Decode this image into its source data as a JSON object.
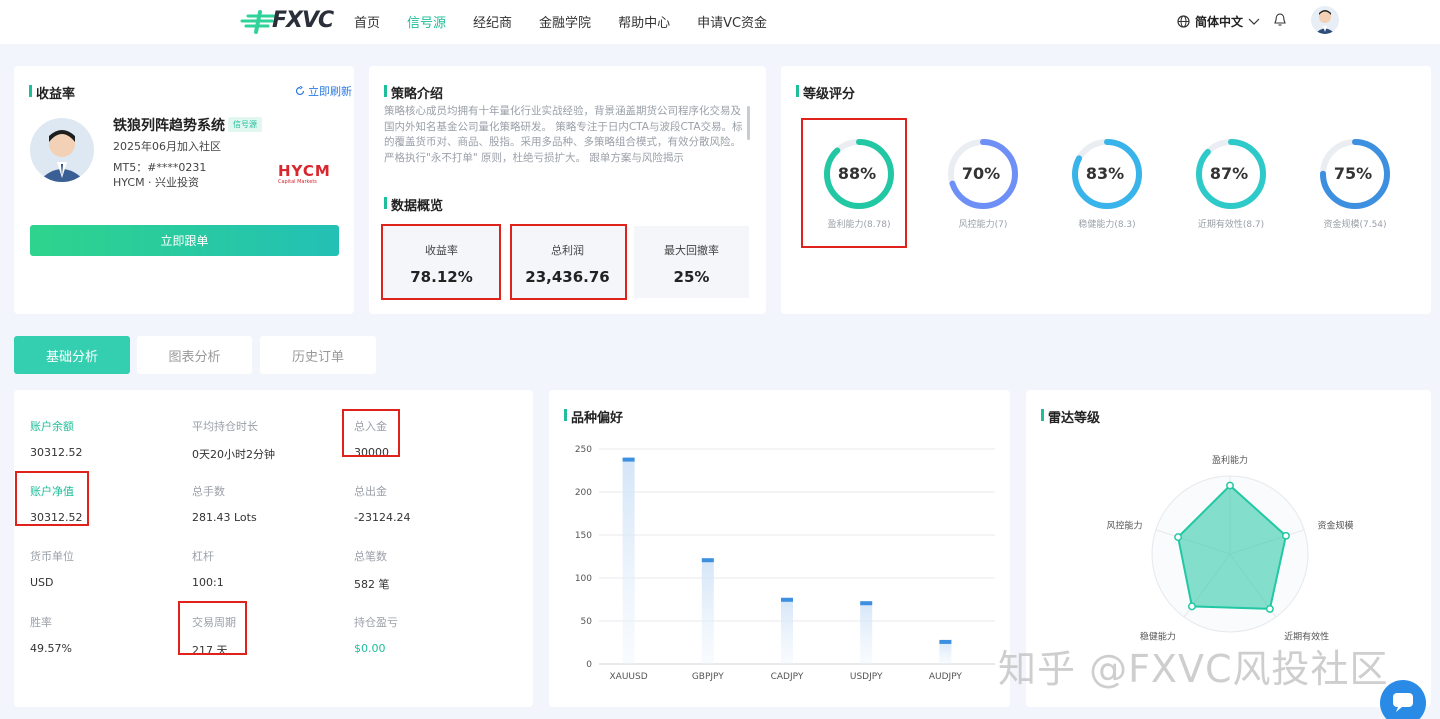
{
  "header": {
    "logo_text": "FXVC",
    "nav": [
      "首页",
      "信号源",
      "经纪商",
      "金融学院",
      "帮助中心",
      "申请VC资金"
    ],
    "active_nav": "信号源",
    "language": "简体中文"
  },
  "profile": {
    "section_title": "收益率",
    "refresh": "立即刷新",
    "name": "铁狼列阵趋势系统",
    "badge": "信号源",
    "joined": "2025年06月加入社区",
    "account": "MT5：#****0231",
    "broker_line": "HYCM · 兴业投资",
    "broker_logo": "HYCM",
    "broker_logo_sub": "Capital Markets",
    "follow": "立即跟单"
  },
  "strategy": {
    "section_title": "策略介绍",
    "text": "策略核心成员均拥有十年量化行业实战经验，背景涵盖期货公司程序化交易及国内外知名基金公司量化策略研发。 策略专注于日内CTA与波段CTA交易。标的覆盖货币对、商品、股指。采用多品种、多策略组合模式，有效分散风险。严格执行\"永不打单\" 原则，杜绝亏损扩大。 跟单方案与风险揭示",
    "overview_title": "数据概览",
    "stats": [
      {
        "label": "收益率",
        "value": "78.12%"
      },
      {
        "label": "总利润",
        "value": "23,436.76"
      },
      {
        "label": "最大回撤率",
        "value": "25%"
      }
    ]
  },
  "rating": {
    "section_title": "等级评分",
    "gauges": [
      {
        "value": "88%",
        "label": "盈利能力(8.78)",
        "pct": 88,
        "color": "#22c7a4"
      },
      {
        "value": "70%",
        "label": "风控能力(7)",
        "pct": 70,
        "color": "#6e8ff5"
      },
      {
        "value": "83%",
        "label": "稳健能力(8.3)",
        "pct": 83,
        "color": "#38b4ea"
      },
      {
        "value": "87%",
        "label": "近期有效性(8.7)",
        "pct": 87,
        "color": "#2ec9c9"
      },
      {
        "value": "75%",
        "label": "资金规模(7.54)",
        "pct": 75,
        "color": "#3d8fe0"
      }
    ]
  },
  "tabs": [
    "基础分析",
    "图表分析",
    "历史订单"
  ],
  "basic": {
    "items": [
      {
        "label": "账户余额",
        "value": "30312.52"
      },
      {
        "label": "平均持仓时长",
        "value": "0天20小时2分钟"
      },
      {
        "label": "总入金",
        "value": "30000"
      },
      {
        "label": "账户净值",
        "value": "30312.52"
      },
      {
        "label": "总手数",
        "value": "281.43 Lots"
      },
      {
        "label": "总出金",
        "value": "-23124.24"
      },
      {
        "label": "货币单位",
        "value": "USD"
      },
      {
        "label": "杠杆",
        "value": "100:1"
      },
      {
        "label": "总笔数",
        "value": "582 笔"
      },
      {
        "label": "胜率",
        "value": "49.57%"
      },
      {
        "label": "交易周期",
        "value": "217 天"
      },
      {
        "label": "持仓盈亏",
        "value": "$0.00"
      }
    ]
  },
  "variety": {
    "section_title": "品种偏好",
    "chart_data": {
      "type": "bar",
      "categories": [
        "XAUUSD",
        "GBPJPY",
        "CADJPY",
        "USDJPY",
        "AUDJPY"
      ],
      "values": [
        240,
        123,
        77,
        73,
        28
      ],
      "ylim": [
        0,
        250
      ],
      "yticks": [
        0,
        50,
        100,
        150,
        200,
        250
      ],
      "color": "#3d8fe0"
    }
  },
  "radar": {
    "section_title": "雷达等级",
    "chart_data": {
      "type": "radar",
      "axes": [
        "盈利能力",
        "资金规模",
        "近期有效性",
        "稳健能力",
        "风控能力"
      ],
      "values": [
        8.78,
        7.54,
        8.7,
        8.3,
        7
      ],
      "max": 10,
      "color": "#22c7a4"
    }
  },
  "watermark": "知乎 @FXVC风投社区"
}
